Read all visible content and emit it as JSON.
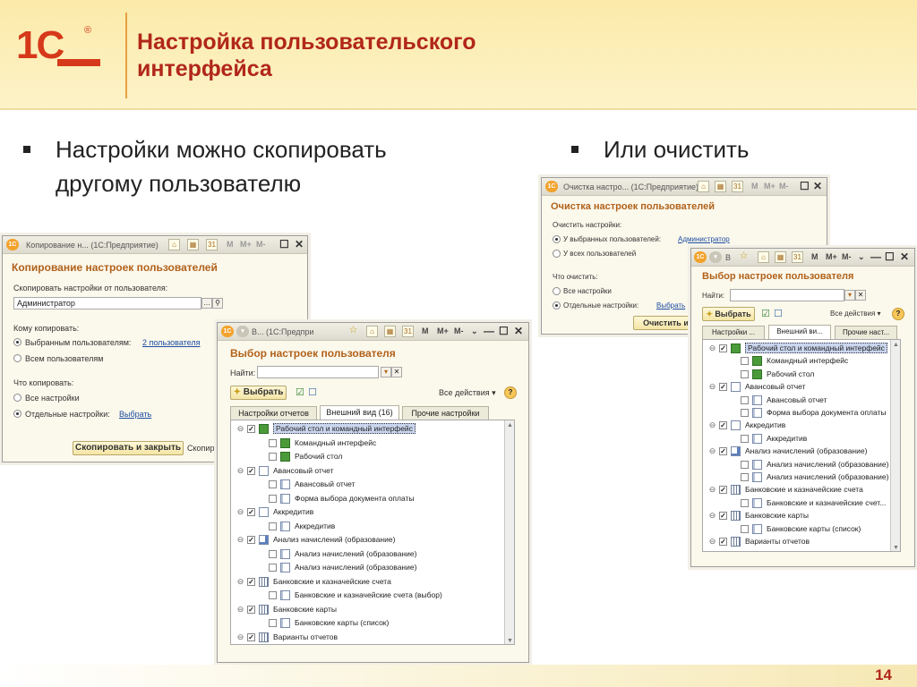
{
  "slide": {
    "title": "Настройка пользовательского\nинтерфейса",
    "bullet_left": "Настройки можно скопировать\nдругому пользователю",
    "bullet_right": "Или очистить",
    "page_number": "14",
    "logo_text": "1С"
  },
  "copy_window": {
    "titlebar": "Копирование н...  (1С:Предприятие)",
    "heading": "Копирование настроек пользователей",
    "from_label": "Скопировать настройки от пользователя:",
    "from_value": "Администратор",
    "to_label": "Кому копировать:",
    "opt_selected": "Выбранным пользователям:",
    "opt_selected_link": "2 пользователя",
    "opt_all": "Всем пользователям",
    "what_label": "Что копировать:",
    "what_all": "Все настройки",
    "what_some": "Отдельные настройки:",
    "what_link": "Выбрать",
    "btn_copy_close": "Скопировать и закрыть",
    "btn_copy": "Скопиро"
  },
  "clear_window": {
    "titlebar": "Очистка настро...  (1С:Предприятие)",
    "heading": "Очистка настроек пользователей",
    "clear_label": "Очистить настройки:",
    "opt_selected": "У выбранных пользователей:",
    "opt_selected_link": "Администратор",
    "opt_all": "У всех пользователей",
    "what_label": "Что очистить:",
    "what_all": "Все настройки",
    "what_some": "Отдельные настройки:",
    "what_link": "Выбрать",
    "btn_clear_close": "Очистить и з"
  },
  "select_left": {
    "titlebar": "В...  (1С:Предпри",
    "heading": "Выбор настроек пользователя",
    "find_label": "Найти:",
    "btn_select": "Выбрать",
    "all_actions": "Все действия",
    "tabs": [
      "Настройки отчетов",
      "Внешний вид (16)",
      "Прочие настройки"
    ]
  },
  "select_right": {
    "titlebar": "В",
    "heading": "Выбор настроек пользователя",
    "find_label": "Найти:",
    "btn_select": "Выбрать",
    "all_actions": "Все действия",
    "tabs": [
      "Настройки ...",
      "Внешний ви...",
      "Прочие наст..."
    ]
  },
  "tree_items": [
    {
      "text": "Рабочий стол и командный интерфейс",
      "level": 0,
      "expand": "⊖",
      "checked": true,
      "icon": "desk",
      "selected": true
    },
    {
      "text": "Командный интерфейс",
      "level": 1,
      "expand": "",
      "checked": false,
      "icon": "desk",
      "selected": false
    },
    {
      "text": "Рабочий стол",
      "level": 1,
      "expand": "",
      "checked": false,
      "icon": "desk",
      "selected": false
    },
    {
      "text": "Авансовый отчет",
      "level": 0,
      "expand": "⊖",
      "checked": true,
      "icon": "doc",
      "selected": false
    },
    {
      "text": "Авансовый отчет",
      "level": 1,
      "expand": "",
      "checked": false,
      "icon": "rep",
      "selected": false
    },
    {
      "text": "Форма выбора документа оплаты",
      "level": 1,
      "expand": "",
      "checked": false,
      "icon": "rep",
      "selected": false
    },
    {
      "text": "Аккредитив",
      "level": 0,
      "expand": "⊖",
      "checked": true,
      "icon": "doc",
      "selected": false
    },
    {
      "text": "Аккредитив",
      "level": 1,
      "expand": "",
      "checked": false,
      "icon": "rep",
      "selected": false
    },
    {
      "text": "Анализ начислений (образование)",
      "level": 0,
      "expand": "⊖",
      "checked": true,
      "icon": "chart",
      "selected": false
    },
    {
      "text": "Анализ начислений (образование)",
      "level": 1,
      "expand": "",
      "checked": false,
      "icon": "rep",
      "selected": false
    },
    {
      "text": "Анализ начислений (образование)",
      "level": 1,
      "expand": "",
      "checked": false,
      "icon": "rep",
      "selected": false
    },
    {
      "text": "Банковские и казначейские счета",
      "level": 0,
      "expand": "⊖",
      "checked": true,
      "icon": "grid",
      "selected": false
    },
    {
      "text": "Банковские и казначейские счета (выбор)",
      "level": 1,
      "expand": "",
      "checked": false,
      "icon": "rep",
      "selected": false
    },
    {
      "text": "Банковские карты",
      "level": 0,
      "expand": "⊖",
      "checked": true,
      "icon": "grid",
      "selected": false
    },
    {
      "text": "Банковские карты (список)",
      "level": 1,
      "expand": "",
      "checked": false,
      "icon": "rep",
      "selected": false
    },
    {
      "text": "Варианты отчетов",
      "level": 0,
      "expand": "⊖",
      "checked": true,
      "icon": "grid",
      "selected": false
    }
  ],
  "tree_items_right_override": {
    "12": "Банковские и казначейские счет..."
  },
  "toolbar": {
    "m": "M",
    "m_plus": "M+",
    "m_minus": "M-",
    "more": "⌄",
    "star": "☆",
    "home": "⌂",
    "cal": "31",
    "calc": "▦",
    "minimize": "—",
    "maximize": "☐",
    "close": "✕",
    "help": "?"
  }
}
